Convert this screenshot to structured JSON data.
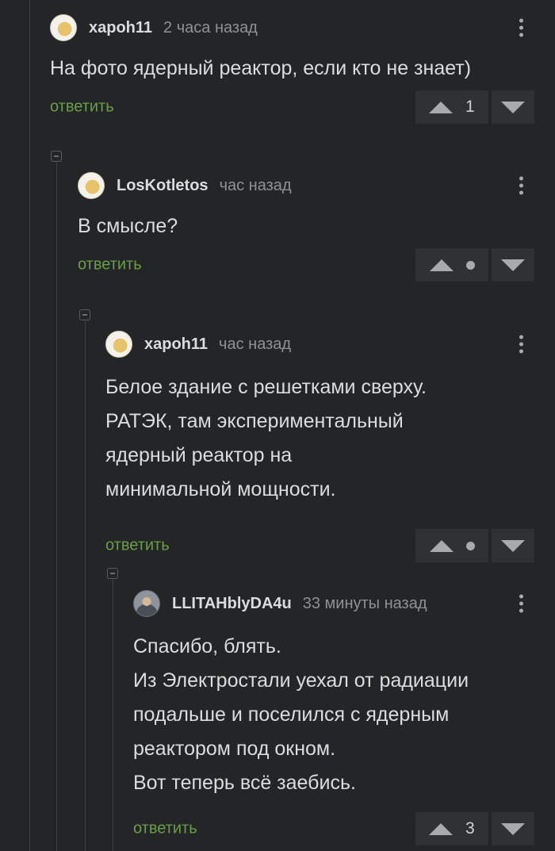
{
  "comments": [
    {
      "user": "xapoh11",
      "time": "2 часа назад",
      "text": [
        "На фото ядерный реактор, если кто не знает)"
      ],
      "reply": "ответить",
      "score": "1"
    },
    {
      "user": "LosKotletos",
      "time": "час назад",
      "text": [
        "В смысле?"
      ],
      "reply": "ответить",
      "score": null
    },
    {
      "user": "xapoh11",
      "time": "час назад",
      "text": [
        "Белое здание с решетками сверху.",
        "РАТЭК, там экспериментальный",
        "ядерный реактор на",
        "минимальной мощности."
      ],
      "reply": "ответить",
      "score": null
    },
    {
      "user": "LLITAHblyDA4u",
      "time": "33 минуты назад",
      "text": [
        "Спасибо, блять.",
        "Из Электростали уехал от радиации",
        "подальше и поселился с ядерным",
        "реактором под окном.",
        "Вот теперь всё заебись."
      ],
      "reply": "ответить",
      "score": "3"
    }
  ],
  "icons": {
    "menu": "more-vertical-icon",
    "upvote": "triangle-up-icon",
    "downvote": "triangle-down-icon",
    "collapse": "collapse-minus-icon"
  },
  "colors": {
    "background": "#242526",
    "reply_link": "#6b9e48",
    "username": "#dcdcdc",
    "timestamp": "#8f9193"
  }
}
